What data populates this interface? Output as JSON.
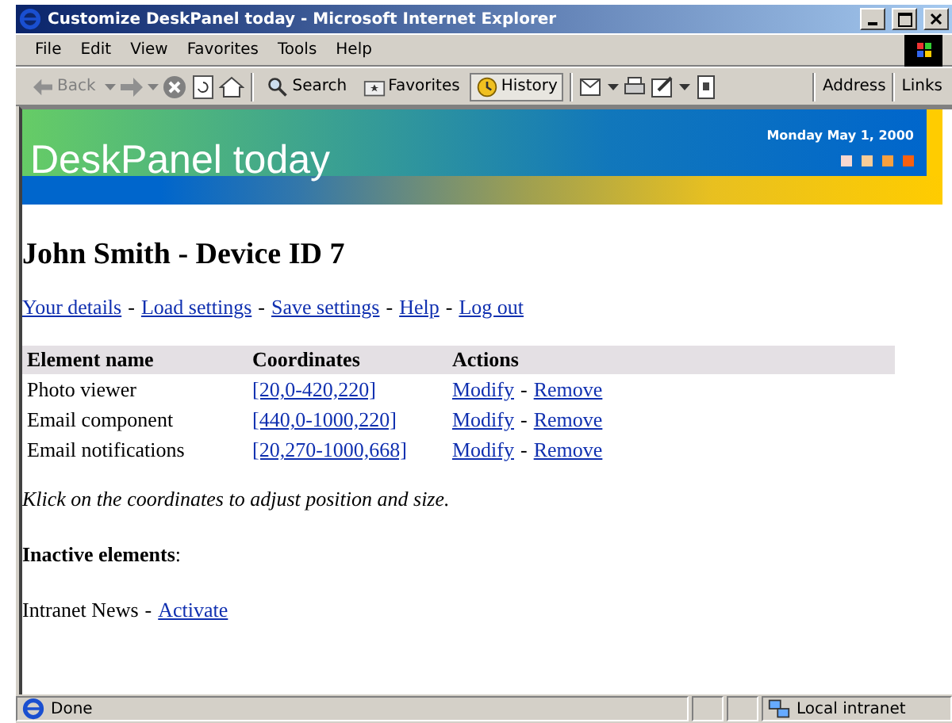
{
  "window": {
    "title": "Customize DeskPanel today - Microsoft Internet Explorer"
  },
  "menu": [
    "File",
    "Edit",
    "View",
    "Favorites",
    "Tools",
    "Help"
  ],
  "toolbar": {
    "back": {
      "label": "Back",
      "disabled": true
    },
    "text_buttons": [
      {
        "label": "Search",
        "selected": false
      },
      {
        "label": "Favorites",
        "selected": false
      },
      {
        "label": "History",
        "selected": true
      }
    ],
    "address_label": "Address",
    "links_label": "Links"
  },
  "banner": {
    "title": "DeskPanel today",
    "date": "Monday May 1, 2000",
    "squares": [
      {
        "color": "#f8d8d0"
      },
      {
        "color": "#f8cc98"
      },
      {
        "color": "#f8a040"
      },
      {
        "color": "#f86010"
      }
    ]
  },
  "page": {
    "heading": "John Smith - Device ID 7",
    "nav": {
      "separator": "-",
      "links": [
        "Your details",
        "Load settings",
        "Save settings",
        "Help",
        "Log out"
      ]
    },
    "table": {
      "columns": [
        "Element name",
        "Coordinates",
        "Actions"
      ],
      "rows": [
        {
          "name": "Photo viewer",
          "coordinates": "[20,0-420,220]",
          "actions": [
            "Modify",
            "Remove"
          ]
        },
        {
          "name": "Email component",
          "coordinates": "[440,0-1000,220]",
          "actions": [
            "Modify",
            "Remove"
          ]
        },
        {
          "name": "Email notifications",
          "coordinates": "[20,270-1000,668]",
          "actions": [
            "Modify",
            "Remove"
          ]
        }
      ]
    },
    "note": "Klick on the coordinates to adjust position and size.",
    "inactive_heading": "**Inactive elements**:",
    "inactive": [
      {
        "name": "Intranet News",
        "action": "Activate"
      }
    ]
  },
  "status_bar": {
    "text": "Done",
    "zone": "Local intranet"
  }
}
